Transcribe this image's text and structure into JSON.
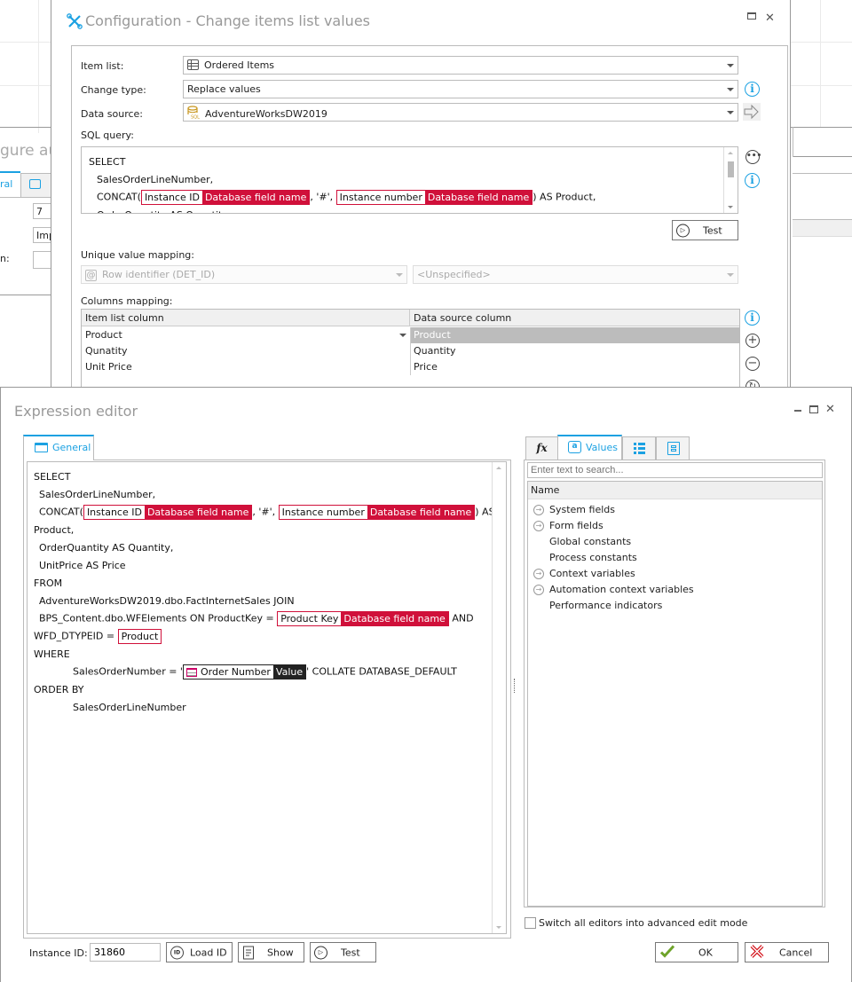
{
  "background_window": {
    "title_fragment": "gure aut",
    "tab_general_fragment": "ral",
    "field_1_value": "7",
    "field_2_value": "Imp",
    "label_fragment": "n:"
  },
  "config_dialog": {
    "title": "Configuration - Change items list values",
    "labels": {
      "item_list": "Item list:",
      "change_type": "Change type:",
      "data_source": "Data source:",
      "sql_query": "SQL query:",
      "unique_value_mapping": "Unique value mapping:",
      "columns_mapping": "Columns mapping:"
    },
    "item_list_value": "Ordered Items",
    "change_type_value": "Replace values",
    "data_source_value": "AdventureWorksDW2019",
    "sql_lines": {
      "l1": "SELECT",
      "l2": "SalesOrderLineNumber,",
      "l3_prefix": "CONCAT(",
      "tok1_name": "Instance ID",
      "tok1_value": "Database field name",
      "l3_mid": ", '#', ",
      "tok2_name": "Instance number",
      "tok2_value": "Database field name",
      "l3_suffix": ") AS Product,",
      "l4_partial": "OrderQuantity AS Quantity,"
    },
    "test_button": "Test",
    "unique_mapping_left": "Row identifier (DET_ID)",
    "unique_mapping_right": "<Unspecified>",
    "columns_grid": {
      "headers": [
        "Item list column",
        "Data source column"
      ],
      "rows": [
        [
          "Product",
          "Product"
        ],
        [
          "Qunatity",
          "Quantity"
        ],
        [
          "Unit Price",
          "Price"
        ]
      ]
    }
  },
  "expression_editor": {
    "title": "Expression editor",
    "tab_general": "General",
    "code": {
      "l1": "SELECT",
      "l2": "SalesOrderLineNumber,",
      "l3_prefix": "CONCAT(",
      "tok1_name": "Instance ID",
      "tok1_value": "Database field name",
      "l3_mid": ", '#', ",
      "tok2_name": "Instance number",
      "tok2_value": "Database field name",
      "l3_suffix": ") AS",
      "l4": "Product,",
      "l5": "OrderQuantity AS Quantity,",
      "l6": "UnitPrice AS Price",
      "l7": "FROM",
      "l8": "AdventureWorksDW2019.dbo.FactInternetSales JOIN",
      "l9_prefix": "BPS_Content.dbo.WFElements ON ProductKey = ",
      "tok3_name": "Product Key",
      "tok3_value": "Database field name",
      "l9_suffix": " AND",
      "l10_prefix": "WFD_DTYPEID = ",
      "tok4_name": "Product",
      "l11": "WHERE",
      "l12_prefix": "SalesOrderNumber = '",
      "tok5_name": "Order Number",
      "tok5_value": "Value",
      "l12_suffix": "' COLLATE DATABASE_DEFAULT",
      "l13": "ORDER BY",
      "l14": "SalesOrderLineNumber"
    },
    "right_tabs": {
      "fx": "fx",
      "values": "Values"
    },
    "search_placeholder": "Enter text to search...",
    "tree_header": "Name",
    "tree_items": [
      {
        "label": "System fields",
        "expandable": true
      },
      {
        "label": "Form fields",
        "expandable": true
      },
      {
        "label": "Global constants",
        "expandable": false
      },
      {
        "label": "Process constants",
        "expandable": false
      },
      {
        "label": "Context variables",
        "expandable": true
      },
      {
        "label": "Automation context variables",
        "expandable": true
      },
      {
        "label": "Performance indicators",
        "expandable": false
      }
    ],
    "advanced_mode_label": "Switch all editors into advanced edit mode",
    "instance_id_label": "Instance ID:",
    "instance_id_value": "31860",
    "load_id_button": "Load ID",
    "show_button": "Show",
    "test_button": "Test",
    "ok_button": "OK",
    "cancel_button": "Cancel"
  },
  "colors": {
    "accent": "#1ba1e2",
    "token_red": "#d0103a",
    "token_dark": "#222222"
  }
}
